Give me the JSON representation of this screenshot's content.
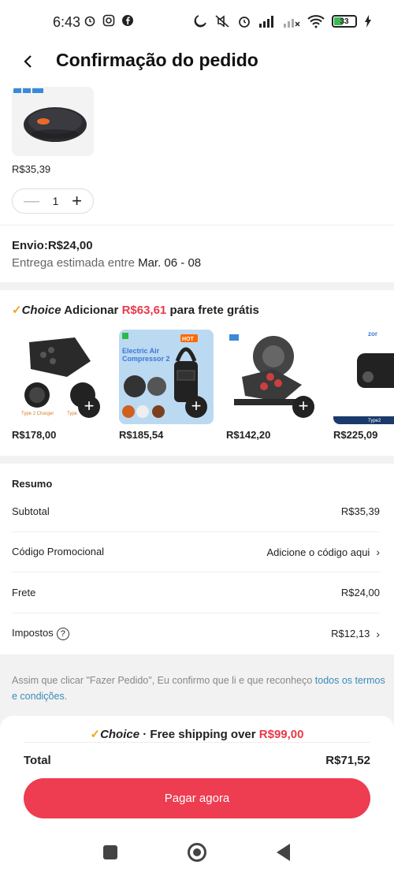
{
  "status": {
    "time": "6:43",
    "battery": "33"
  },
  "header": {
    "title": "Confirmação do pedido"
  },
  "product": {
    "price": "R$35,39",
    "quantity": "1"
  },
  "shipping": {
    "envio": "Envio:R$24,00",
    "entrega_prefix": "Entrega estimada entre ",
    "entrega_dates": "Mar. 06 - 08"
  },
  "choice": {
    "logo": "Choice",
    "prefix": " Adicionar ",
    "amount": "R$63,61",
    "suffix": " para frete grátis",
    "items": [
      {
        "price": "R$178,00",
        "label1": "Type 2 Charger",
        "label2": "Type"
      },
      {
        "price": "R$185,54",
        "label1": "Electric Air",
        "label2": "Compressor 2",
        "badge": "HOT"
      },
      {
        "price": "R$142,20"
      },
      {
        "price": "R$225,09",
        "label1": "Type2",
        "brand": "zor"
      }
    ]
  },
  "summary": {
    "title": "Resumo",
    "subtotal_label": "Subtotal",
    "subtotal_value": "R$35,39",
    "promo_label": "Código Promocional",
    "promo_value": "Adicione o código aqui",
    "frete_label": "Frete",
    "frete_value": "R$24,00",
    "impostos_label": "Impostos",
    "impostos_value": "R$12,13"
  },
  "terms": {
    "text": "Assim que clicar \"Fazer Pedido\", Eu confirmo que li e que reconheço ",
    "link": "todos os termos e condições",
    "end": "."
  },
  "checkout": {
    "promo_logo": "Choice",
    "promo_text": " · Free shipping over ",
    "promo_amount": "R$99,00",
    "total_label": "Total",
    "total_value": "R$71,52",
    "pay_label": "Pagar agora"
  },
  "colors": {
    "accent": "#ee3c51",
    "choice": "#f2a31b",
    "link": "#3a8ab8"
  }
}
